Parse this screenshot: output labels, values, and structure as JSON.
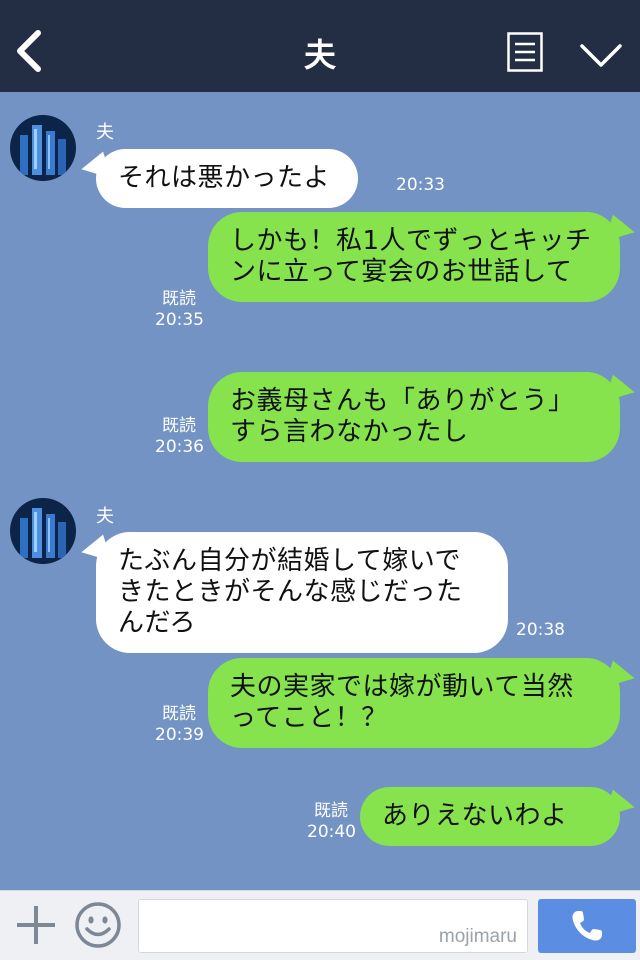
{
  "header": {
    "title": "夫",
    "back_icon": "chevron-left-icon",
    "menu_icon": "menu-list-icon",
    "collapse_icon": "chevron-down-icon"
  },
  "messages": [
    {
      "direction": "in",
      "sender": "夫",
      "text": "それは悪かったよ",
      "time": "20:33"
    },
    {
      "direction": "out",
      "text": "しかも！私1人でずっとキッチンに立って宴会のお世話して",
      "read": "既読",
      "time": "20:35"
    },
    {
      "direction": "out",
      "text": "お義母さんも「ありがとう」すら言わなかったし",
      "read": "既読",
      "time": "20:36"
    },
    {
      "direction": "in",
      "sender": "夫",
      "text": "たぶん自分が結婚して嫁いできたときがそんな感じだったんだろ",
      "time": "20:38"
    },
    {
      "direction": "out",
      "text": "夫の実家では嫁が動いて当然ってこと！？",
      "read": "既読",
      "time": "20:39"
    },
    {
      "direction": "out",
      "text": "ありえないわよ",
      "read": "既読",
      "time": "20:40"
    }
  ],
  "input": {
    "placeholder": "",
    "watermark": "mojimaru",
    "plus_icon": "plus-icon",
    "emoji_icon": "smiley-icon",
    "call_icon": "phone-icon"
  },
  "colors": {
    "header_bg": "#232d43",
    "chat_bg": "#7293c3",
    "outgoing_bubble": "#86e34d",
    "incoming_bubble": "#ffffff",
    "call_button": "#5b8ee2"
  }
}
